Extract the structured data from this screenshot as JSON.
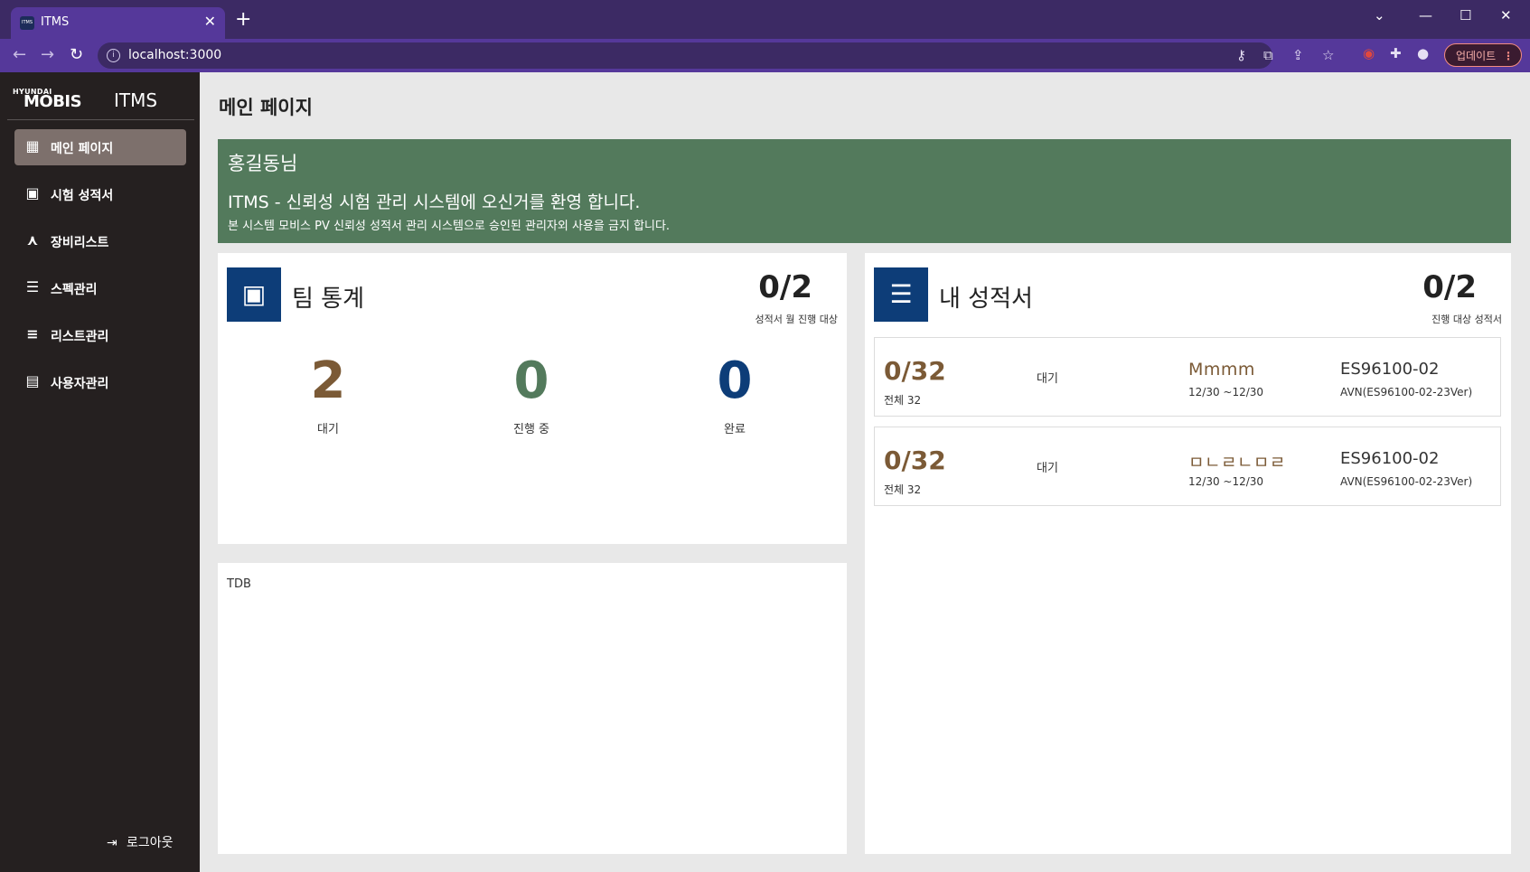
{
  "browser": {
    "tab_title": "ITMS",
    "tab_favicon_text": "ITMS",
    "url": "localhost:3000",
    "update_label": "업데이트",
    "accent": "#55389a"
  },
  "sidebar": {
    "logo_small": "HYUNDAI",
    "logo_main": "MOBIS",
    "app_name": "ITMS",
    "items": [
      {
        "label": "메인 페이지",
        "icon": "dashboard-icon",
        "active": true
      },
      {
        "label": "시험 성적서",
        "icon": "clipboard-icon",
        "active": false
      },
      {
        "label": "장비리스트",
        "icon": "network-icon",
        "active": false
      },
      {
        "label": "스펙관리",
        "icon": "document-icon",
        "active": false
      },
      {
        "label": "리스트관리",
        "icon": "list-icon",
        "active": false
      },
      {
        "label": "사용자관리",
        "icon": "user-card-icon",
        "active": false
      }
    ],
    "logout_label": "로그아웃"
  },
  "main": {
    "page_title": "메인 페이지",
    "banner": {
      "user": "홍길동님",
      "welcome": "ITMS - 신뢰성 시험 관리 시스템에 오신거를 환영 합니다.",
      "notice": "본 시스템 모비스 PV 신뢰성 성적서 관리 시스템으로 승인된 관리자외 사용을 금지 합니다.",
      "color": "#537a5c"
    },
    "team_stats": {
      "title": "팀 통계",
      "ratio": "0/2",
      "ratio_label": "성적서 월 진행 대상",
      "stats": [
        {
          "value": "2",
          "label": "대기",
          "color": "#7b5a36"
        },
        {
          "value": "0",
          "label": "진행 중",
          "color": "#537a5c"
        },
        {
          "value": "0",
          "label": "완료",
          "color": "#0d3d78"
        }
      ]
    },
    "tdb_text": "TDB",
    "my_reports": {
      "title": "내 성적서",
      "ratio": "0/2",
      "ratio_label": "진행 대상 성적서",
      "items": [
        {
          "count": "0/32",
          "total": "전체 32",
          "status": "대기",
          "name": "Mmmm",
          "date": "12/30 ~12/30",
          "code": "ES96100-02",
          "sub": "AVN(ES96100-02-23Ver)"
        },
        {
          "count": "0/32",
          "total": "전체 32",
          "status": "대기",
          "name": "ㅁㄴㄹㄴㅁㄹ",
          "date": "12/30 ~12/30",
          "code": "ES96100-02",
          "sub": "AVN(ES96100-02-23Ver)"
        }
      ]
    }
  }
}
